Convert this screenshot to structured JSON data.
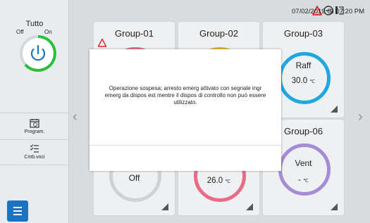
{
  "left_panel": {
    "all_label": "Tutto",
    "off_label": "Off",
    "on_label": "On",
    "program_label": "Program.",
    "change_items_label": "Cmb.voci"
  },
  "header": {
    "datetime": "07/02/2019 Gi 07:20 PM"
  },
  "groups": [
    {
      "name": "Group-01",
      "mode": "",
      "temp": "",
      "unit": ""
    },
    {
      "name": "Group-02",
      "mode": "",
      "temp": "",
      "unit": ""
    },
    {
      "name": "Group-03",
      "mode": "Raff",
      "temp": "30.0",
      "unit": "℃"
    },
    {
      "name": "",
      "mode": "Off",
      "temp": "",
      "unit": ""
    },
    {
      "name": "",
      "mode": "",
      "temp": "26.0",
      "unit": "℃"
    },
    {
      "name": "Group-06",
      "mode": "Vent",
      "temp": "-",
      "unit": "℃"
    }
  ],
  "colors": {
    "power_on": "#2bbf3a",
    "accent_blue": "#1b73c4",
    "ring_group01": "#e86c85",
    "ring_group02": "#e6b32b",
    "ring_group03": "#1fa7e0",
    "ring_group04": "#cfd1d6",
    "ring_group05": "#e86c85",
    "ring_group06": "#a58ad6",
    "alarm_red": "#d9262a"
  },
  "modal": {
    "message": "Operazione sospesa; arresto emerg attivato con segnale ingr emerg da dispos est mentre il dispos di controllo non può essere utilizzato."
  }
}
